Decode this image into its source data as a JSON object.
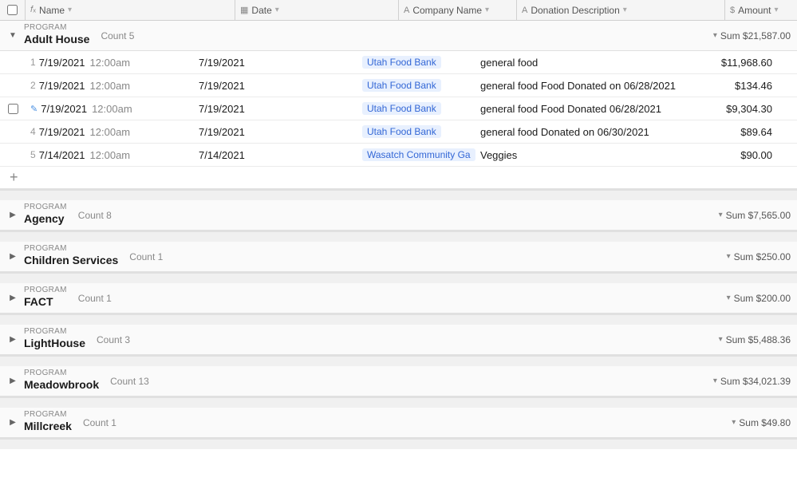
{
  "header": {
    "checkbox_col": "",
    "name_label": "Name",
    "date_label": "Date",
    "company_label": "Company Name",
    "desc_label": "Donation Description",
    "amount_label": "Amount"
  },
  "groups": [
    {
      "id": "adult-house",
      "program_label": "PROGRAM",
      "name": "Adult House",
      "expanded": true,
      "count": 5,
      "sum": "$21,587.00",
      "rows": [
        {
          "num": "1",
          "date": "7/19/2021",
          "time": "12:00am",
          "date2": "7/19/2021",
          "company": "Utah Food Bank",
          "desc": "general food",
          "amount": "$11,968.60",
          "editing": false
        },
        {
          "num": "2",
          "date": "7/19/2021",
          "time": "12:00am",
          "date2": "7/19/2021",
          "company": "Utah Food Bank",
          "desc": "general food Food Donated on 06/28/2021",
          "amount": "$134.46",
          "editing": false
        },
        {
          "num": "",
          "date": "7/19/2021",
          "time": "12:00am",
          "date2": "7/19/2021",
          "company": "Utah Food Bank",
          "desc": "general food Food Donated 06/28/2021",
          "amount": "$9,304.30",
          "editing": true
        },
        {
          "num": "4",
          "date": "7/19/2021",
          "time": "12:00am",
          "date2": "7/19/2021",
          "company": "Utah Food Bank",
          "desc": "general food Donated on 06/30/2021",
          "amount": "$89.64",
          "editing": false
        },
        {
          "num": "5",
          "date": "7/14/2021",
          "time": "12:00am",
          "date2": "7/14/2021",
          "company": "Wasatch Community Ga",
          "desc": "Veggies",
          "amount": "$90.00",
          "editing": false
        }
      ]
    },
    {
      "id": "agency",
      "program_label": "PROGRAM",
      "name": "Agency",
      "expanded": false,
      "count": 8,
      "sum": "$7,565.00",
      "rows": []
    },
    {
      "id": "children-services",
      "program_label": "PROGRAM",
      "name": "Children Services",
      "expanded": false,
      "count": 1,
      "sum": "$250.00",
      "rows": []
    },
    {
      "id": "fact",
      "program_label": "PROGRAM",
      "name": "FACT",
      "expanded": false,
      "count": 1,
      "sum": "$200.00",
      "rows": []
    },
    {
      "id": "lighthouse",
      "program_label": "PROGRAM",
      "name": "LightHouse",
      "expanded": false,
      "count": 3,
      "sum": "$5,488.36",
      "rows": []
    },
    {
      "id": "meadowbrook",
      "program_label": "PROGRAM",
      "name": "Meadowbrook",
      "expanded": false,
      "count": 13,
      "sum": "$34,021.39",
      "rows": []
    },
    {
      "id": "millcreek",
      "program_label": "PROGRAM",
      "name": "Millcreek",
      "expanded": false,
      "count": 1,
      "sum": "$49.80",
      "rows": []
    }
  ],
  "labels": {
    "add": "+",
    "count_prefix": "Count ",
    "sum_prefix": "Sum "
  }
}
